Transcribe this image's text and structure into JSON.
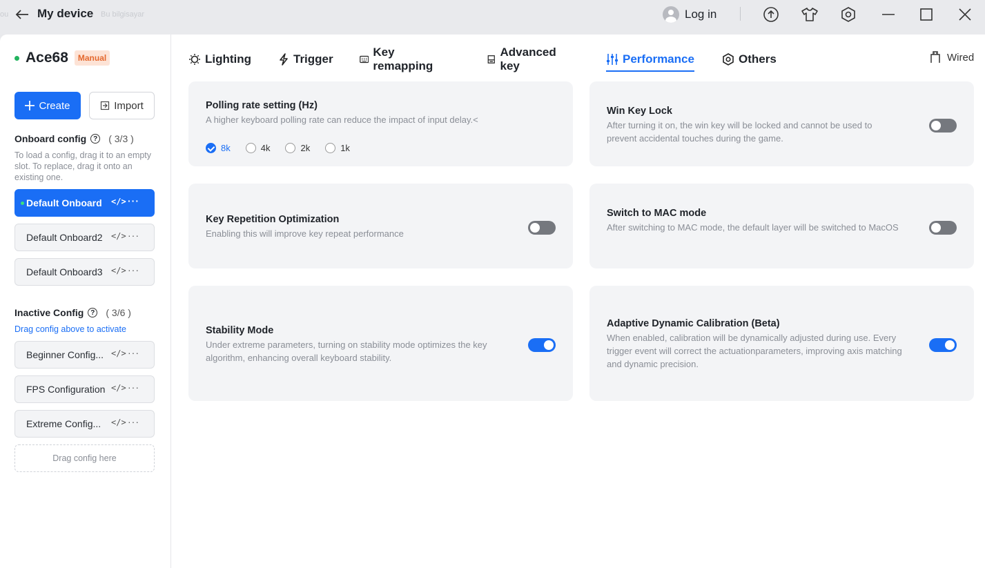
{
  "window": {
    "title": "My device",
    "ghost_text_1": "Bu bilgisayar",
    "login_label": "Log in"
  },
  "device": {
    "name": "Ace68",
    "mode_badge": "Manual"
  },
  "sidebar": {
    "create_label": "Create",
    "import_label": "Import",
    "onboard": {
      "title": "Onboard config",
      "count": "( 3/3 )",
      "description": "To load a config, drag it to an empty slot. To replace, drag it onto an existing one.",
      "items": [
        {
          "label": "Default Onboard",
          "active": true
        },
        {
          "label": "Default Onboard2"
        },
        {
          "label": "Default Onboard3"
        }
      ]
    },
    "inactive": {
      "title": "Inactive Config",
      "count": "( 3/6 )",
      "description": "Drag config above to activate",
      "items": [
        {
          "label": "Beginner Config..."
        },
        {
          "label": "FPS Configuration"
        },
        {
          "label": "Extreme Config..."
        }
      ],
      "drop_placeholder": "Drag config here"
    },
    "item_code_glyph": "</>",
    "item_more_glyph": "···"
  },
  "tabs": [
    {
      "label": "Lighting",
      "icon": "bulb-icon"
    },
    {
      "label": "Trigger",
      "icon": "bolt-icon"
    },
    {
      "label": "Key remapping",
      "icon": "keyboard-icon"
    },
    {
      "label": "Advanced key",
      "icon": "key-icon"
    },
    {
      "label": "Performance",
      "icon": "sliders-icon",
      "active": true
    },
    {
      "label": "Others",
      "icon": "hexagon-settings-icon"
    }
  ],
  "connection": {
    "label": "Wired"
  },
  "settings": {
    "polling": {
      "title": "Polling rate setting (Hz)",
      "description": "A higher keyboard polling rate can reduce the impact of input delay.<",
      "options": [
        "8k",
        "4k",
        "2k",
        "1k"
      ],
      "selected": "8k"
    },
    "win_lock": {
      "title": "Win Key Lock",
      "description": "After turning it on, the win key will be locked and cannot be used to prevent accidental touches during the game.",
      "enabled": false
    },
    "key_repetition": {
      "title": "Key Repetition Optimization",
      "description": "Enabling this will improve key repeat performance",
      "enabled": false
    },
    "mac_mode": {
      "title": "Switch to MAC mode",
      "description": "After switching to MAC mode, the default layer will be switched to MacOS",
      "enabled": false
    },
    "stability": {
      "title": "Stability Mode",
      "description": "Under extreme parameters, turning on stability mode optimizes the key algorithm, enhancing overall keyboard stability.",
      "enabled": true
    },
    "adaptive": {
      "title": "Adaptive Dynamic Calibration (Beta)",
      "description": "When enabled, calibration will be dynamically adjusted during use. Every trigger event will correct the actuationparameters, improving axis matching and dynamic precision.",
      "enabled": true
    }
  },
  "colors": {
    "accent": "#1a6ef5",
    "badge_text": "#e4692f",
    "badge_bg": "#fde3d6",
    "status_dot": "#22b35e"
  }
}
